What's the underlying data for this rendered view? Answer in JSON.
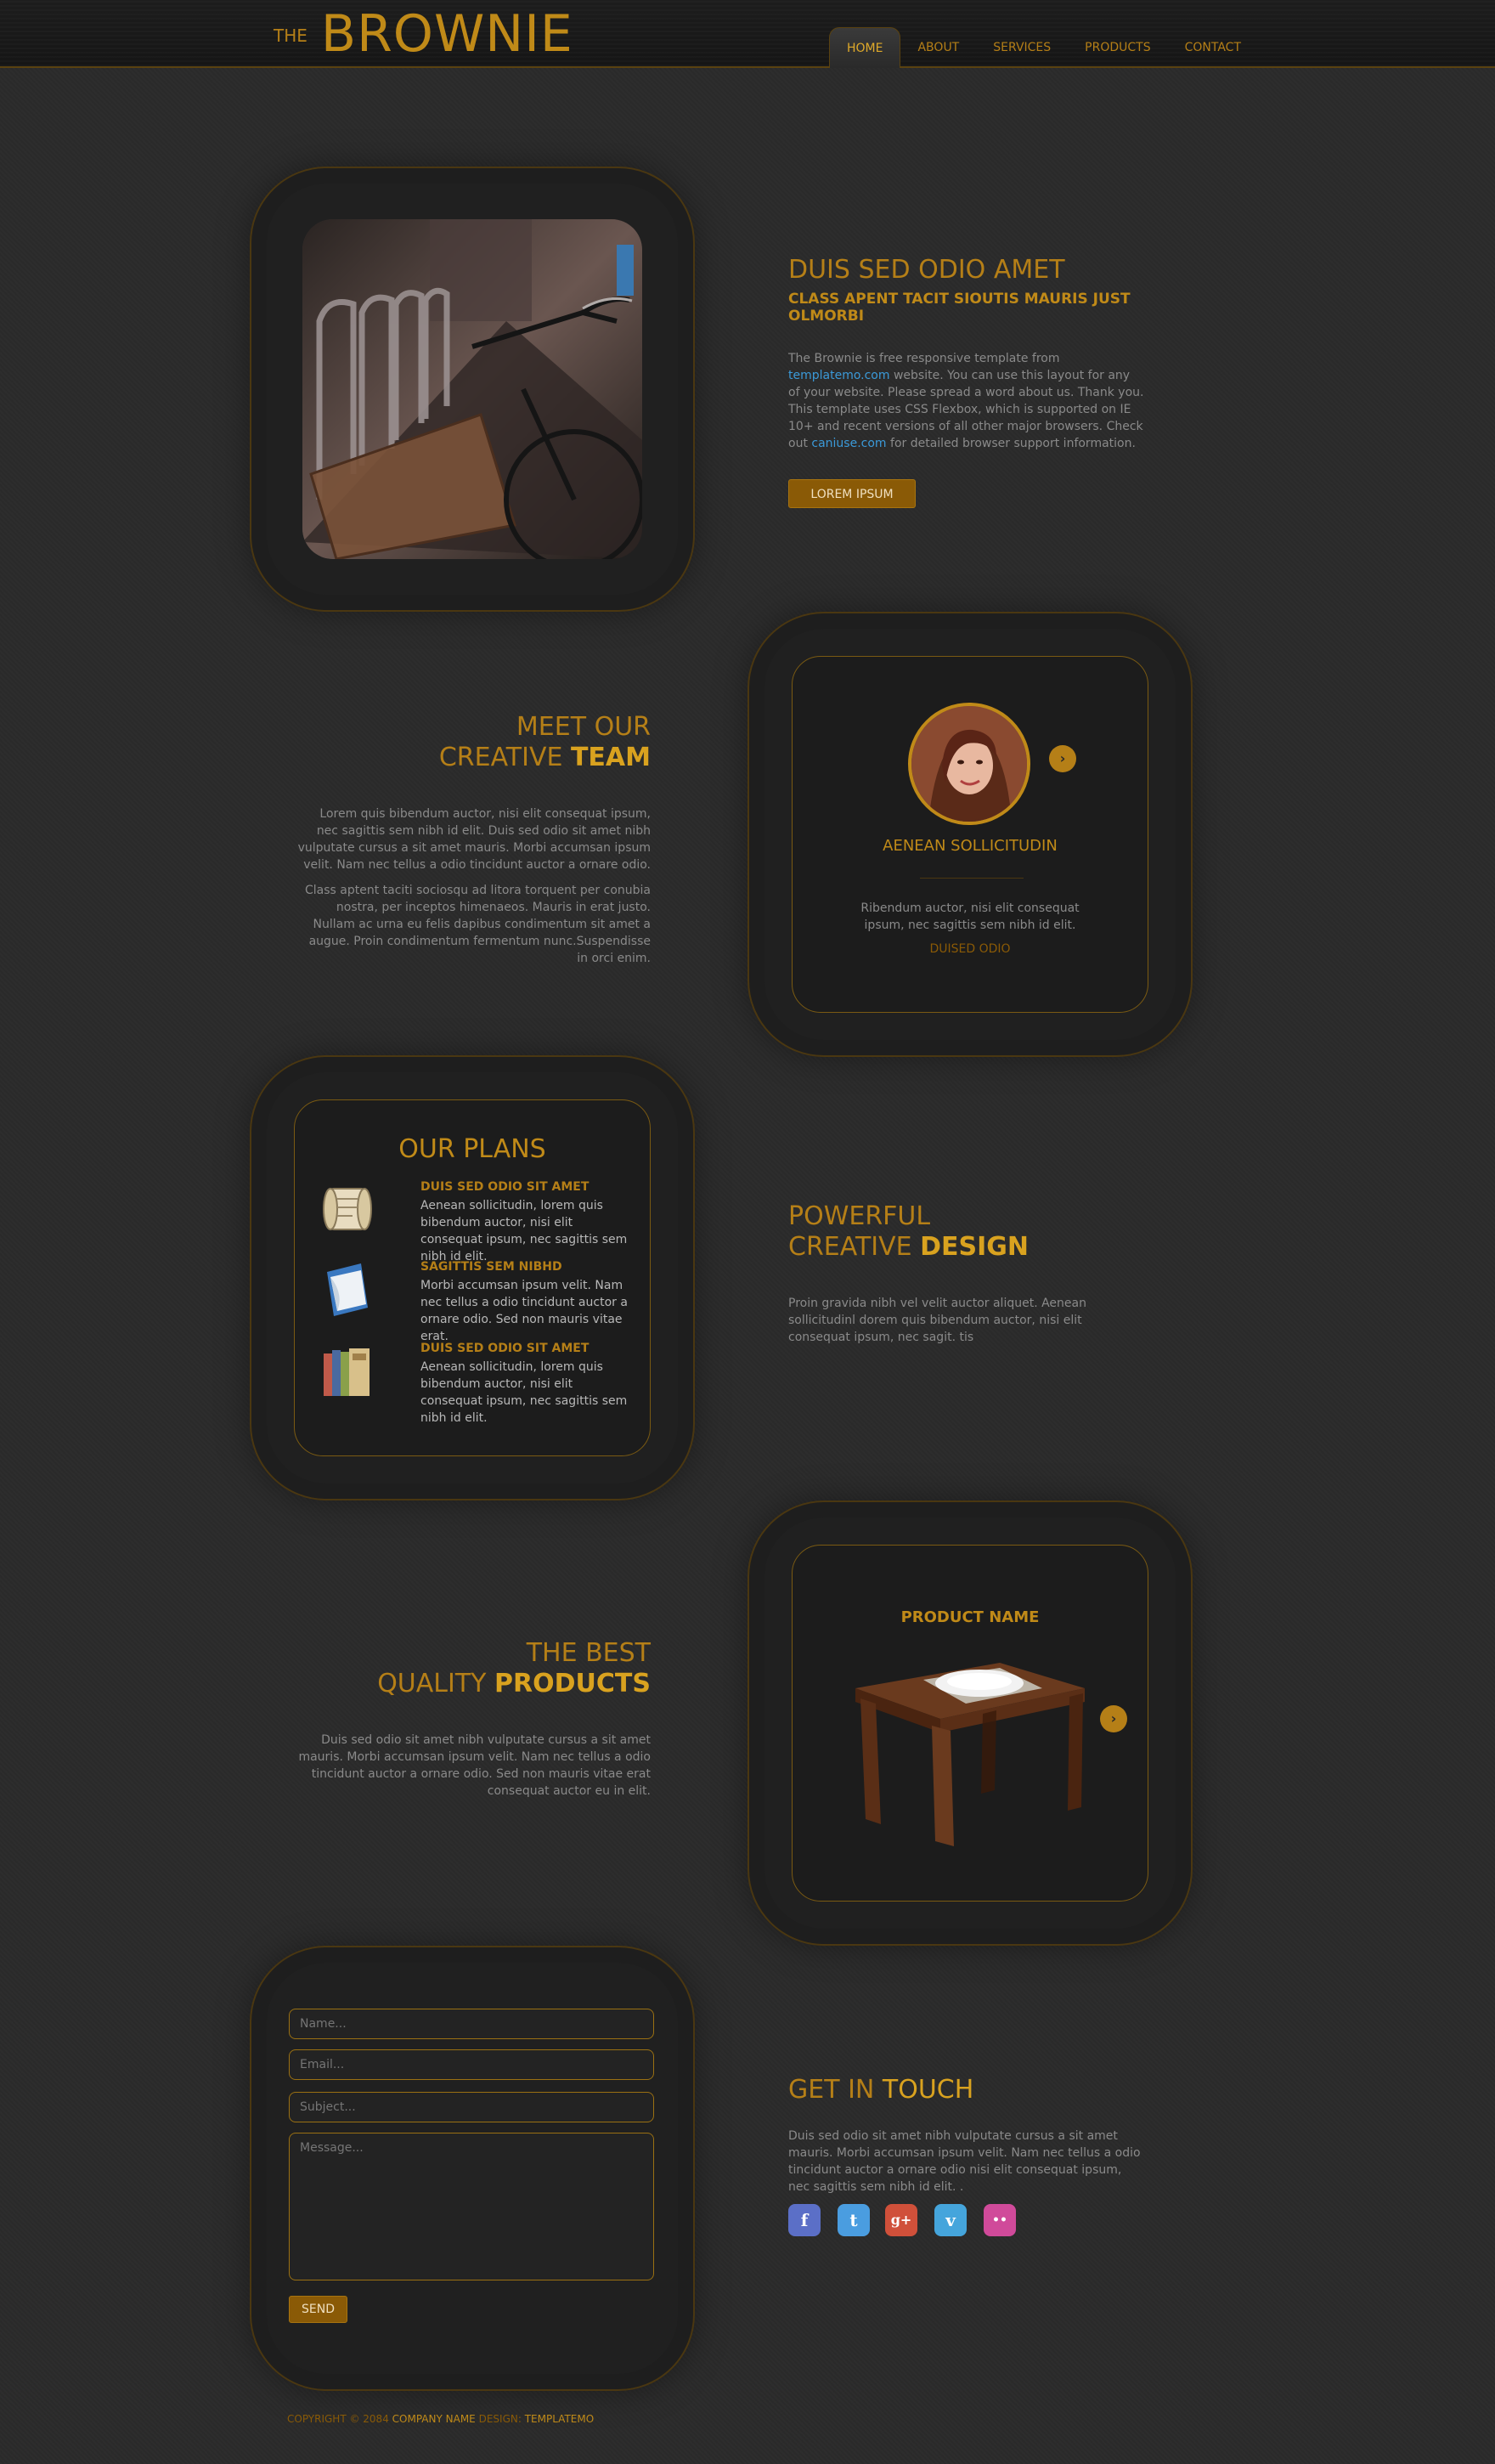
{
  "header": {
    "logo_prefix": "THE",
    "logo_name": "BROWNIE",
    "nav": [
      {
        "label": "HOME",
        "active": true
      },
      {
        "label": "ABOUT",
        "active": false
      },
      {
        "label": "SERVICES",
        "active": false
      },
      {
        "label": "PRODUCTS",
        "active": false
      },
      {
        "label": "CONTACT",
        "active": false
      }
    ]
  },
  "intro": {
    "title": "DUIS SED ODIO AMET",
    "subtitle": "CLASS APENT TACIT SIOUTIS MAURIS JUST OLMORBI",
    "text_1": "The Brownie is free responsive template from",
    "link_1": "templatemo.com",
    "text_2": "website. You can use this layout for any of your website. Please spread a word about us. Thank you. This template uses CSS Flexbox, which is supported on IE 10+ and recent versions of all other major browsers. Check out",
    "link_2": "caniuse.com",
    "text_3": "for detailed browser support information.",
    "button": "LOREM IPSUM"
  },
  "team": {
    "title_1": "MEET OUR",
    "title_2a": "CREATIVE",
    "title_2b": "TEAM",
    "para_1": "Lorem quis bibendum auctor, nisi elit consequat ipsum, nec sagittis sem nibh id elit. Duis sed odio sit amet nibh vulputate cursus a sit amet mauris. Morbi accumsan ipsum velit. Nam nec tellus a odio tincidunt auctor a ornare odio.",
    "para_2": "Class aptent taciti sociosqu ad litora torquent per conubia nostra, per inceptos himenaeos. Mauris in erat justo. Nullam ac urna eu felis dapibus condimentum sit amet a augue. Proin condimentum fermentum nunc.Suspendisse in orci enim.",
    "member_name": "AENEAN SOLLICITUDIN",
    "member_text": "Ribendum auctor, nisi elit consequat ipsum, nec sagittis sem nibh id elit.",
    "member_role": "DUISED ODIO",
    "arrow": "›"
  },
  "plans": {
    "title": "OUR PLANS",
    "items": [
      {
        "heading": "DUIS SED ODIO SIT AMET",
        "text": "Aenean sollicitudin, lorem quis bibendum auctor, nisi elit consequat ipsum, nec sagittis sem nibh id elit.",
        "icon": "scroll-icon"
      },
      {
        "heading": "SAGITTIS SEM NIBHD",
        "text": "Morbi accumsan ipsum velit. Nam nec tellus a odio tincidunt auctor a ornare odio. Sed non mauris vitae erat.",
        "icon": "paper-icon"
      },
      {
        "heading": "DUIS SED ODIO SIT AMET",
        "text": "Aenean sollicitudin, lorem quis bibendum auctor, nisi elit consequat ipsum, nec sagittis sem nibh id elit.",
        "icon": "books-icon"
      }
    ]
  },
  "design": {
    "title_1": "POWERFUL",
    "title_2a": "CREATIVE",
    "title_2b": "DESIGN",
    "text": "Proin gravida nibh vel velit auctor aliquet. Aenean sollicitudinl dorem quis bibendum auctor, nisi elit consequat ipsum, nec sagit. tis"
  },
  "products": {
    "title_1": "THE BEST",
    "title_2a": "QUALITY",
    "title_2b": "PRODUCTS",
    "text": "Duis sed odio sit amet nibh vulputate cursus a sit amet mauris. Morbi accumsan ipsum velit. Nam nec tellus a odio tincidunt auctor a ornare odio. Sed non mauris vitae erat consequat auctor eu in elit.",
    "product_name": "PRODUCT NAME",
    "arrow": "›"
  },
  "contact": {
    "name_placeholder": "Name...",
    "email_placeholder": "Email...",
    "subject_placeholder": "Subject...",
    "message_placeholder": "Message...",
    "send": "SEND",
    "title_a": "GET IN",
    "title_b": "TOUCH",
    "text": "Duis sed odio sit amet nibh vulputate cursus a sit amet mauris. Morbi accumsan ipsum velit. Nam nec tellus a odio tincidunt auctor a ornare odio nisi elit consequat ipsum, nec sagittis sem nibh id elit. .",
    "social": [
      {
        "glyph": "f",
        "color": "#5b6fc7",
        "icon": "facebook-icon"
      },
      {
        "glyph": "t",
        "color": "#4a9de0",
        "icon": "twitter-icon"
      },
      {
        "glyph": "g+",
        "color": "#d0503a",
        "icon": "google-plus-icon"
      },
      {
        "glyph": "v",
        "color": "#45a5dc",
        "icon": "vimeo-icon"
      },
      {
        "glyph": "••",
        "color": "#d04a9a",
        "icon": "flickr-icon"
      }
    ]
  },
  "footer": {
    "copyright": "COPYRIGHT © 2084",
    "company": "COMPANY NAME",
    "design_label": "DESIGN:",
    "designer": "TEMPLATEMO"
  }
}
